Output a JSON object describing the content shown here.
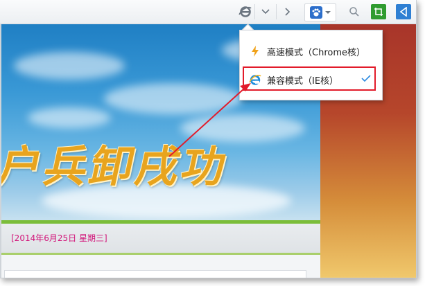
{
  "toolbar": {
    "icons": [
      "ie-compat-icon",
      "chevron-down-icon",
      "forward-icon",
      "paw-icon",
      "search-icon",
      "crop-icon",
      "share-icon"
    ]
  },
  "page": {
    "banner_text": "户兵卸戌功",
    "date_text": "[2014年6月25日  星期三]"
  },
  "menu": {
    "items": [
      {
        "label": "高速模式（Chrome核）",
        "icon": "lightning-icon",
        "selected": false
      },
      {
        "label": "兼容模式（IE核）",
        "icon": "ie-icon",
        "selected": true
      }
    ]
  },
  "colors": {
    "accent_red": "#e21b2a",
    "date_pink": "#d21479",
    "crop_green": "#2f9b2f",
    "share_blue": "#2e7fd3"
  }
}
